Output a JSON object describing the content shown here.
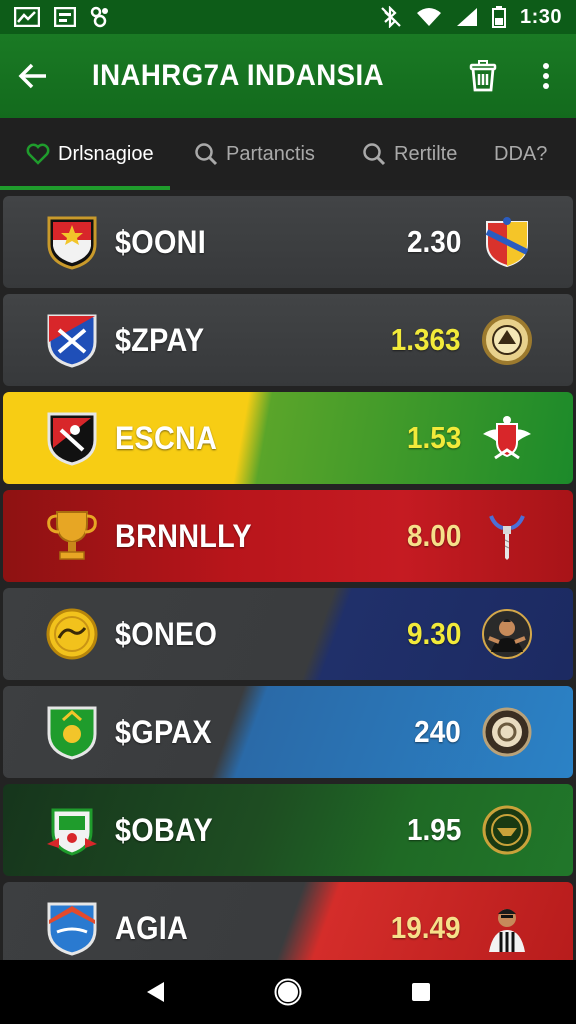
{
  "status_bar": {
    "time": "1:30",
    "left_icons": [
      "chart-icon",
      "calendar-icon",
      "game-icon"
    ],
    "right_icons": [
      "bluetooth-off-icon",
      "wifi-icon",
      "signal-icon",
      "battery-icon"
    ]
  },
  "app_bar": {
    "title": "INAHRG7A INDANSIA",
    "back_icon": "arrow-left-icon",
    "actions": [
      "trash-icon",
      "more-vertical-icon"
    ]
  },
  "tabs": [
    {
      "label": "Drlsnagioe",
      "icon": "heart-icon",
      "active": true
    },
    {
      "label": "Partanctis",
      "icon": "search-icon",
      "active": false
    },
    {
      "label": "Rertilte",
      "icon": "search-icon",
      "active": false
    },
    {
      "label": "DDA?",
      "icon": "",
      "active": false
    }
  ],
  "rows": [
    {
      "name": "$OONI",
      "odds": "2.30",
      "odds_color": "#ffffff",
      "theme": "gray"
    },
    {
      "name": "$ZPAY",
      "odds": "1.363",
      "odds_color": "#f2ea3a",
      "theme": "gray"
    },
    {
      "name": "ESCNA",
      "odds": "1.53",
      "odds_color": "#f2ea3a",
      "theme": "yellow-green"
    },
    {
      "name": "BRNNLLY",
      "odds": "8.00",
      "odds_color": "#f6e08a",
      "theme": "red"
    },
    {
      "name": "$ONEO",
      "odds": "9.30",
      "odds_color": "#f2ea3a",
      "theme": "gray-navy"
    },
    {
      "name": "$GPAX",
      "odds": "240",
      "odds_color": "#ffffff",
      "theme": "gray-blue"
    },
    {
      "name": "$OBAY",
      "odds": "1.95",
      "odds_color": "#ffffff",
      "theme": "darkgreen"
    },
    {
      "name": "AGIA",
      "odds": "19.49",
      "odds_color": "#f6e08a",
      "theme": "gray-red"
    }
  ],
  "nav_bar": {
    "buttons": [
      "back-triangle-icon",
      "home-circle-icon",
      "recents-square-icon"
    ]
  },
  "colors": {
    "accent": "#1f9c2c",
    "app_bar": "#1a7a24",
    "status_bar": "#0d5c18"
  }
}
